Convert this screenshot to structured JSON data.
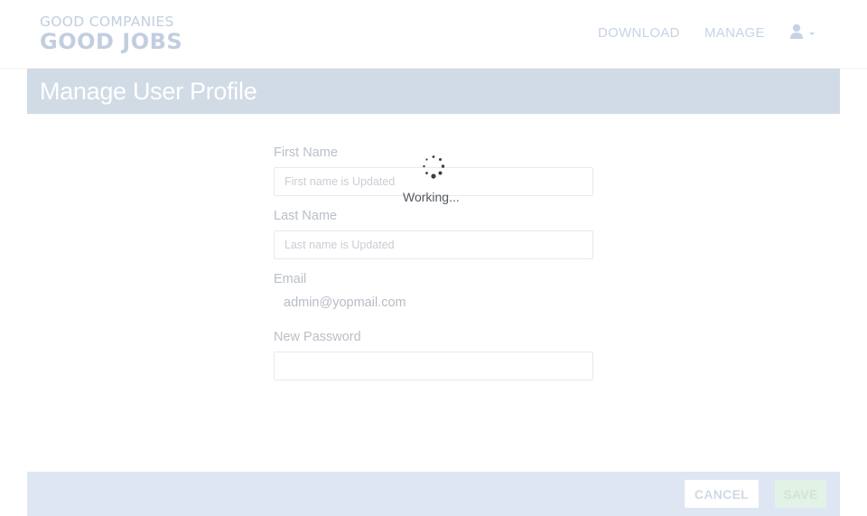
{
  "brand": {
    "line1": "GOOD COMPANIES",
    "line2": "GOOD JOBS"
  },
  "nav": {
    "download": "DOWNLOAD",
    "manage": "MANAGE",
    "user_icon": "user-icon"
  },
  "page": {
    "title": "Manage User Profile"
  },
  "form": {
    "first_name": {
      "label": "First Name",
      "placeholder": "First name is Updated",
      "value": ""
    },
    "last_name": {
      "label": "Last Name",
      "placeholder": "Last name is Updated",
      "value": ""
    },
    "email": {
      "label": "Email",
      "value": "admin@yopmail.com"
    },
    "new_password": {
      "label": "New Password",
      "value": ""
    }
  },
  "loading": {
    "text": "Working..."
  },
  "footer": {
    "cancel": "CANCEL",
    "save": "SAVE"
  },
  "colors": {
    "banner": "#d0dbe6",
    "footer": "#dde6f2",
    "save": "#e3f2e6"
  }
}
